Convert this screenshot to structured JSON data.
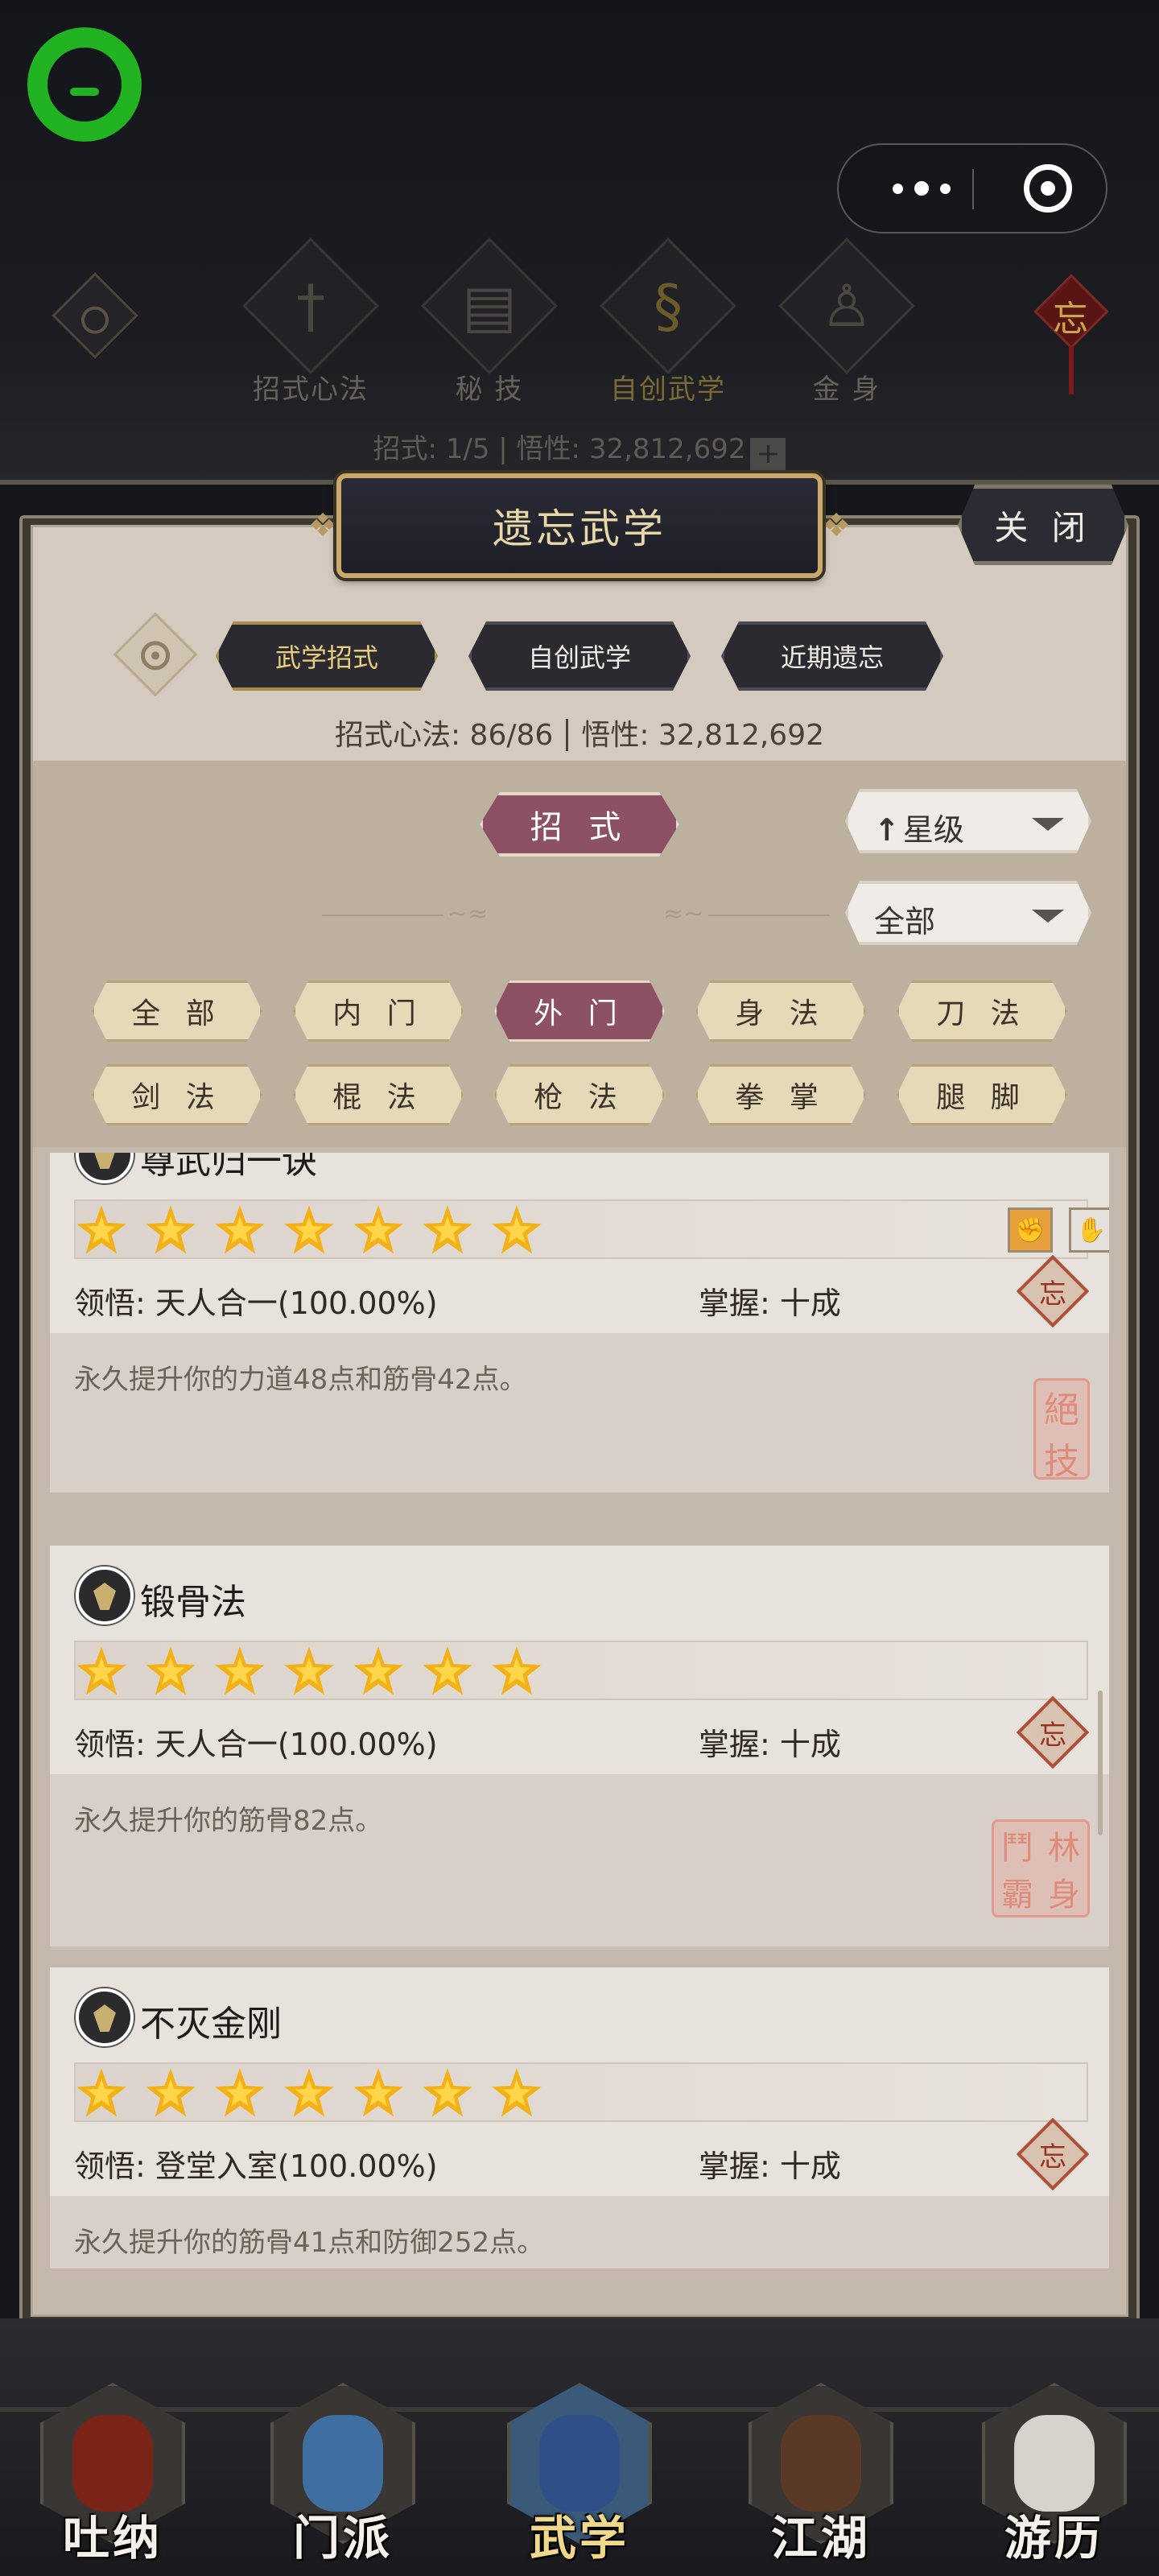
{
  "top": {
    "tabs": [
      {
        "label": "招式心法",
        "glyph": "†"
      },
      {
        "label": "秘 技",
        "glyph": "▤"
      },
      {
        "label": "自创武学",
        "glyph": "§"
      },
      {
        "label": "金 身",
        "glyph": "♙"
      }
    ],
    "stat": "招式: 1/5 | 悟性: 32,812,692",
    "knot_char": "忘"
  },
  "modal": {
    "title": "遗忘武学",
    "close_label": "关 闭",
    "tabs": [
      "武学招式",
      "自创武学",
      "近期遗忘"
    ],
    "stat_left": "招式心法: 86/86",
    "stat_right": "悟性: 32,812,692",
    "type_button": "招 式",
    "sort_select": "星级",
    "scope_select": "全部",
    "categories_row1": [
      "全 部",
      "内 门",
      "外 门",
      "身 法",
      "刀 法"
    ],
    "categories_row2": [
      "剑 法",
      "棍 法",
      "枪 法",
      "拳 掌",
      "腿 脚"
    ]
  },
  "list": [
    {
      "name": "尊武归一诀",
      "stars": 7,
      "insight": "领悟: 天人合一(100.00%)",
      "mastery": "掌握: 十成",
      "desc": "永久提升你的力道48点和筋骨42点。",
      "seal": [
        "絕",
        "技"
      ],
      "badges": [
        "fist-badge",
        "skill-badge"
      ]
    },
    {
      "name": "锻骨法",
      "stars": 7,
      "insight": "领悟: 天人合一(100.00%)",
      "mastery": "掌握: 十成",
      "desc": "永久提升你的筋骨82点。",
      "seal": [
        "鬥",
        "林",
        "霸",
        "身"
      ]
    },
    {
      "name": "不灭金刚",
      "stars": 7,
      "insight": "领悟: 登堂入室(100.00%)",
      "mastery": "掌握: 十成",
      "desc": "永久提升你的筋骨41点和防御252点。"
    }
  ],
  "forget_char": "忘",
  "bottom_nav": [
    "吐纳",
    "门派",
    "武学",
    "江湖",
    "游历"
  ],
  "colors": {
    "accent_rose": "#8c5263",
    "star_gold": "#f3b118",
    "gold_text": "#e9cf7e"
  }
}
